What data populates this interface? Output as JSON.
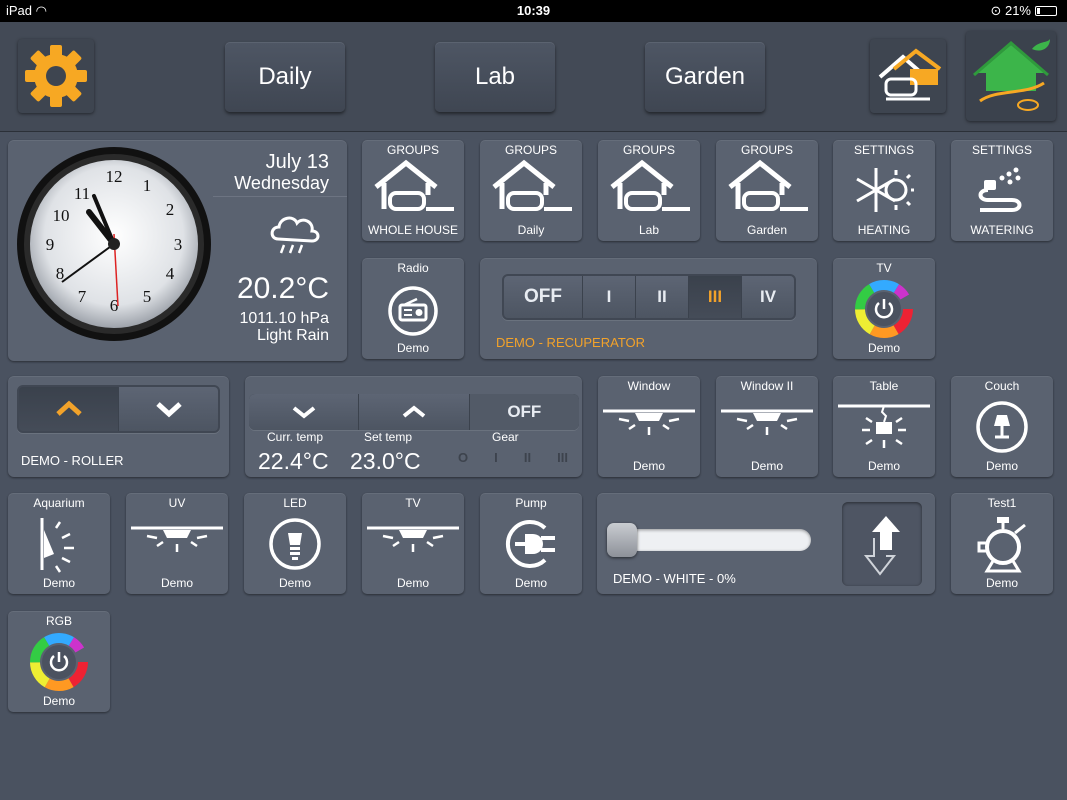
{
  "status": {
    "device": "iPad",
    "time": "10:39",
    "battery": "21%"
  },
  "header": {
    "tabs": [
      {
        "label": "Daily"
      },
      {
        "label": "Lab"
      },
      {
        "label": "Garden"
      }
    ]
  },
  "clock": {
    "date": "July 13",
    "weekday": "Wednesday",
    "temperature": "20.2°C",
    "pressure": "1011.10 hPa",
    "condition": "Light Rain"
  },
  "group_tiles": [
    {
      "top": "GROUPS",
      "bottom": "WHOLE HOUSE"
    },
    {
      "top": "GROUPS",
      "bottom": "Daily"
    },
    {
      "top": "GROUPS",
      "bottom": "Lab"
    },
    {
      "top": "GROUPS",
      "bottom": "Garden"
    }
  ],
  "settings_tiles": [
    {
      "top": "SETTINGS",
      "bottom": "HEATING"
    },
    {
      "top": "SETTINGS",
      "bottom": "WATERING"
    }
  ],
  "radio": {
    "top": "Radio",
    "bottom": "Demo"
  },
  "recuperator": {
    "label": "DEMO - RECUPERATOR",
    "options": [
      "OFF",
      "I",
      "II",
      "III",
      "IV"
    ],
    "active": "III"
  },
  "tv1": {
    "top": "TV",
    "bottom": "Demo"
  },
  "roller": {
    "label": "DEMO - ROLLER"
  },
  "thermostat": {
    "off_label": "OFF",
    "curr_label": "Curr. temp",
    "curr_value": "22.4°C",
    "set_label": "Set temp",
    "set_value": "23.0°C",
    "gear_label": "Gear",
    "gears": [
      "O",
      "I",
      "II",
      "III"
    ]
  },
  "light_tiles_row3": [
    {
      "top": "Window",
      "bottom": "Demo"
    },
    {
      "top": "Window II",
      "bottom": "Demo"
    },
    {
      "top": "Table",
      "bottom": "Demo"
    },
    {
      "top": "Couch",
      "bottom": "Demo"
    }
  ],
  "row4_tiles": [
    {
      "top": "Aquarium",
      "bottom": "Demo"
    },
    {
      "top": "UV",
      "bottom": "Demo"
    },
    {
      "top": "LED",
      "bottom": "Demo"
    },
    {
      "top": "TV",
      "bottom": "Demo"
    },
    {
      "top": "Pump",
      "bottom": "Demo"
    }
  ],
  "dimmer": {
    "label": "DEMO - WHITE - 0%",
    "level_percent": 0
  },
  "test1": {
    "top": "Test1",
    "bottom": "Demo"
  },
  "rgb": {
    "top": "RGB",
    "bottom": "Demo"
  },
  "colors": {
    "accent": "#f2a22a",
    "background": "#4a5260",
    "tile": "#5a6270",
    "house_green": "#3cb54a"
  }
}
